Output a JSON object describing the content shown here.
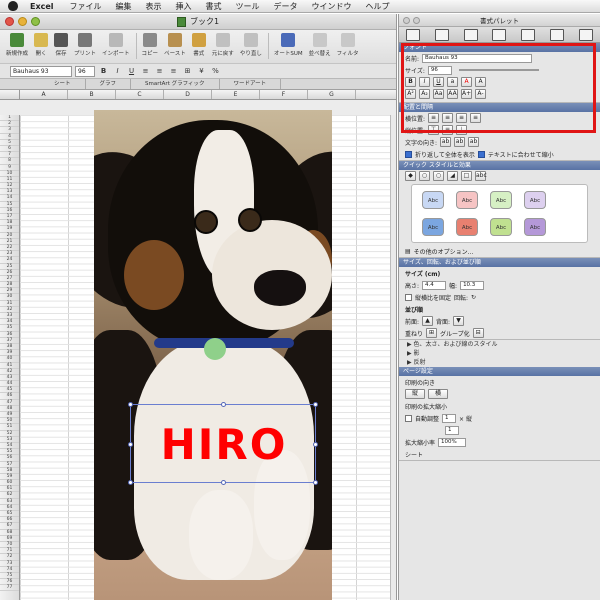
{
  "menubar": {
    "app": "Excel",
    "items": [
      "ファイル",
      "編集",
      "表示",
      "挿入",
      "書式",
      "ツール",
      "データ",
      "ウインドウ",
      "ヘルプ"
    ]
  },
  "excel": {
    "window_title": "ブック1",
    "toolbar": [
      "新規作成",
      "開く",
      "保存",
      "プリント",
      "インポート",
      "コピー",
      "ペースト",
      "書式",
      "元に戻す",
      "やり直し",
      "オートSUM",
      "並べ替え",
      "フィルタ"
    ],
    "format": {
      "font": "Bauhaus 93",
      "size": "96",
      "zoom_label": "%"
    },
    "ribbon_tabs": [
      "シート",
      "グラフ",
      "SmartArt グラフィック",
      "ワードアート"
    ],
    "columns": [
      "A",
      "B",
      "C",
      "D",
      "E",
      "F",
      "G"
    ],
    "rows_start": 1,
    "rows_end": 77,
    "textbox_text": "HIRO",
    "textbox_color": "#ff0000"
  },
  "palette": {
    "title": "書式パレット",
    "font": {
      "header": "フォント",
      "name_label": "名前:",
      "name_value": "Bauhaus 93",
      "size_label": "サイズ:",
      "size_value": "96"
    },
    "alignment": {
      "header": "配置と間隔",
      "horizontal_label": "横位置:",
      "vertical_label": "縦位置:",
      "direction_label": "文字の向き:",
      "wrap_label": "折り返して全体を表示",
      "fit_label": "テキストに合わせて縮小"
    },
    "quick_styles": {
      "header": "クイック スタイルと効果",
      "swatches": [
        "Abc",
        "Abc",
        "Abc",
        "Abc",
        "Abc",
        "Abc",
        "Abc",
        "Abc"
      ],
      "swatch_colors": [
        "#c8d8f4",
        "#f6c4c4",
        "#d6f0c4",
        "#ddd0ef",
        "#7ba6e0",
        "#e88070",
        "#c0e090",
        "#b498d8"
      ],
      "more_options": "その他のオプション..."
    },
    "size_rotation": {
      "header": "サイズ、回転、および並び順",
      "size_label": "サイズ (cm)",
      "height_label": "高さ:",
      "height_value": "4.4",
      "width_label": "幅:",
      "width_value": "10.3",
      "lock_label": "縦横比を固定",
      "rotate_label": "回転:",
      "order_label": "並び順",
      "front_label": "前面:",
      "back_label": "背面:",
      "arrange_label": "重ねり",
      "group_label": "グループ化"
    },
    "collapsed": [
      "色、太さ、および線のスタイル",
      "影",
      "反射"
    ],
    "page_setup": {
      "header": "ページ設定",
      "orientation_label": "印刷の向き",
      "portrait_label": "縦",
      "landscape_label": "横",
      "scale_label": "印刷の拡大縮小",
      "fit_label": "自動調整",
      "fit_w": "1",
      "fit_h": "1",
      "x_label": "× 縦",
      "horiz_label": "横",
      "zoom_label": "拡大縮小率",
      "zoom_value": "100%",
      "sheet_label": "シート"
    }
  }
}
